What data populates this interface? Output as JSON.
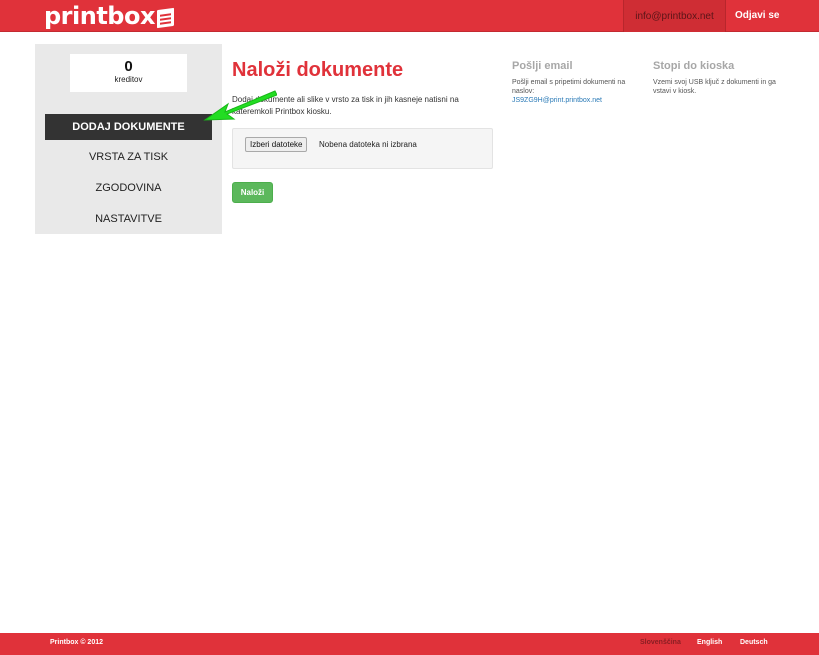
{
  "header": {
    "logo_text": "printbox",
    "email": "info@printbox.net",
    "logout_label": "Odjavi se"
  },
  "sidebar": {
    "credits_value": "0",
    "credits_label": "kreditov",
    "items": [
      {
        "label": "DODAJ DOKUMENTE",
        "active": true
      },
      {
        "label": "VRSTA ZA TISK",
        "active": false
      },
      {
        "label": "ZGODOVINA",
        "active": false
      },
      {
        "label": "NASTAVITVE",
        "active": false
      }
    ]
  },
  "main": {
    "title": "Naloži dokumente",
    "intro": "Dodaj dokumente ali slike v vrsto za tisk in jih kasneje natisni na kateremkoli Printbox kiosku.",
    "file_button_label": "Izberi datoteke",
    "file_status": "Nobena datoteka ni izbrana",
    "submit_label": "Naloži"
  },
  "info": {
    "email_title": "Pošlji email",
    "email_text": "Pošlji email s pripetimi dokumenti na naslov:",
    "email_address": "JS9ZG9H@print.printbox.net",
    "kiosk_title": "Stopi do kioska",
    "kiosk_text": "Vzemi svoj USB ključ z dokumenti in ga vstavi v kiosk."
  },
  "footer": {
    "copyright": "Printbox © 2012",
    "languages": [
      "Slovenščina",
      "English",
      "Deutsch"
    ]
  },
  "colors": {
    "brand_red": "#e0323a",
    "active_nav": "#333333",
    "submit_green": "#5cb85c",
    "arrow_green": "#22dd22",
    "link_blue": "#2a7ab7"
  }
}
